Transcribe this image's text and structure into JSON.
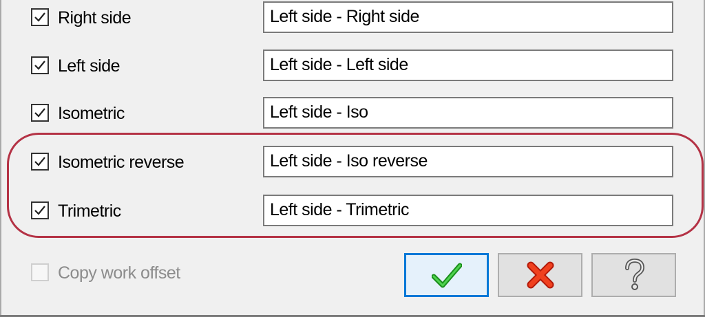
{
  "rows": [
    {
      "label": "Right side",
      "checked": true,
      "value": "Left side - Right side"
    },
    {
      "label": "Left side",
      "checked": true,
      "value": "Left side - Left side"
    },
    {
      "label": "Isometric",
      "checked": true,
      "value": "Left side - Iso"
    },
    {
      "label": "Isometric reverse",
      "checked": true,
      "value": "Left side - Iso reverse"
    },
    {
      "label": "Trimetric",
      "checked": true,
      "value": "Left side - Trimetric"
    }
  ],
  "copy_work_offset": {
    "label": "Copy work offset",
    "checked": false,
    "enabled": false
  },
  "buttons": {
    "ok_icon": "checkmark-icon",
    "cancel_icon": "red-x-icon",
    "help_icon": "question-mark-icon"
  },
  "colors": {
    "highlight": "#b43245",
    "ok_check": "#22a822",
    "cancel_x": "#e52b14",
    "default_button_border": "#0078d7"
  }
}
